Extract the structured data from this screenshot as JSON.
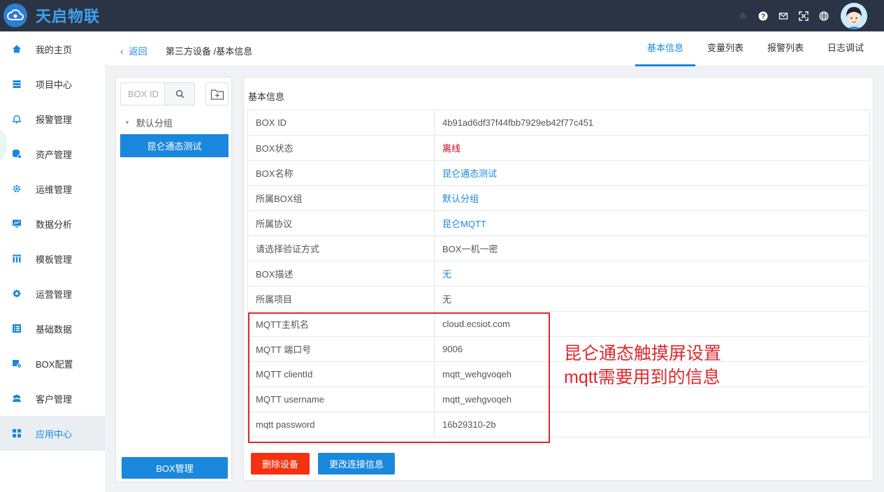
{
  "app": {
    "brand": "天启物联",
    "accent": "#1a88dc"
  },
  "topbar": {
    "icons": [
      "bell-icon",
      "help-icon",
      "mail-icon",
      "fullscreen-icon",
      "globe-icon"
    ]
  },
  "sidebar": {
    "items": [
      {
        "label": "我的主页",
        "icon": "home-icon",
        "active": false
      },
      {
        "label": "项目中心",
        "icon": "stack-icon",
        "active": false
      },
      {
        "label": "报警管理",
        "icon": "bell-icon",
        "active": false
      },
      {
        "label": "资产管理",
        "icon": "database-icon",
        "active": false
      },
      {
        "label": "运维管理",
        "icon": "gear-icon",
        "active": false
      },
      {
        "label": "数据分析",
        "icon": "monitor-chart-icon",
        "active": false
      },
      {
        "label": "模板管理",
        "icon": "bars-icon",
        "active": false
      },
      {
        "label": "运营管理",
        "icon": "cog-ring-icon",
        "active": false
      },
      {
        "label": "基础数据",
        "icon": "list-icon",
        "active": false
      },
      {
        "label": "BOX配置",
        "icon": "device-gear-icon",
        "active": false
      },
      {
        "label": "客户管理",
        "icon": "users-icon",
        "active": false
      },
      {
        "label": "应用中心",
        "icon": "apps-icon",
        "active": true
      }
    ]
  },
  "header": {
    "back_label": "返回",
    "breadcrumb": "第三方设备 /基本信息",
    "tabs": [
      {
        "label": "基本信息",
        "active": true
      },
      {
        "label": "变量列表",
        "active": false
      },
      {
        "label": "报警列表",
        "active": false
      },
      {
        "label": "日志调试",
        "active": false
      }
    ]
  },
  "left_panel": {
    "search_placeholder": "BOX ID",
    "group_label": "默认分组",
    "selected_device": "昆仑通态测试",
    "manage_button": "BOX管理"
  },
  "info": {
    "title": "基本信息",
    "rows": [
      {
        "key": "BOX ID",
        "value": "4b91ad6df37f44fbb7929eb42f77c451",
        "style": ""
      },
      {
        "key": "BOX状态",
        "value": "离线",
        "style": "red"
      },
      {
        "key": "BOX名称",
        "value": "昆仑通态测试",
        "style": "blue"
      },
      {
        "key": "所属BOX组",
        "value": "默认分组",
        "style": "blue"
      },
      {
        "key": "所属协议",
        "value": "昆仑MQTT",
        "style": "blue"
      },
      {
        "key": "请选择验证方式",
        "value": "BOX一机一密",
        "style": ""
      },
      {
        "key": "BOX描述",
        "value": "无",
        "style": "blue"
      },
      {
        "key": "所属项目",
        "value": "无",
        "style": ""
      },
      {
        "key": "MQTT主机名",
        "value": "cloud.ecsiot.com",
        "style": ""
      },
      {
        "key": "MQTT 端口号",
        "value": "9006",
        "style": ""
      },
      {
        "key": "MQTT clientId",
        "value": "mqtt_wehgvoqeh",
        "style": ""
      },
      {
        "key": "MQTT username",
        "value": "mqtt_wehgvoqeh",
        "style": ""
      },
      {
        "key": "mqtt password",
        "value": "16b29310-2b",
        "style": ""
      }
    ],
    "delete_button": "删除设备",
    "update_button": "更改连接信息"
  },
  "annotation": {
    "line1": "昆仑通态触摸屏设置",
    "line2": "mqtt需要用到的信息",
    "color": "#e0262c"
  }
}
